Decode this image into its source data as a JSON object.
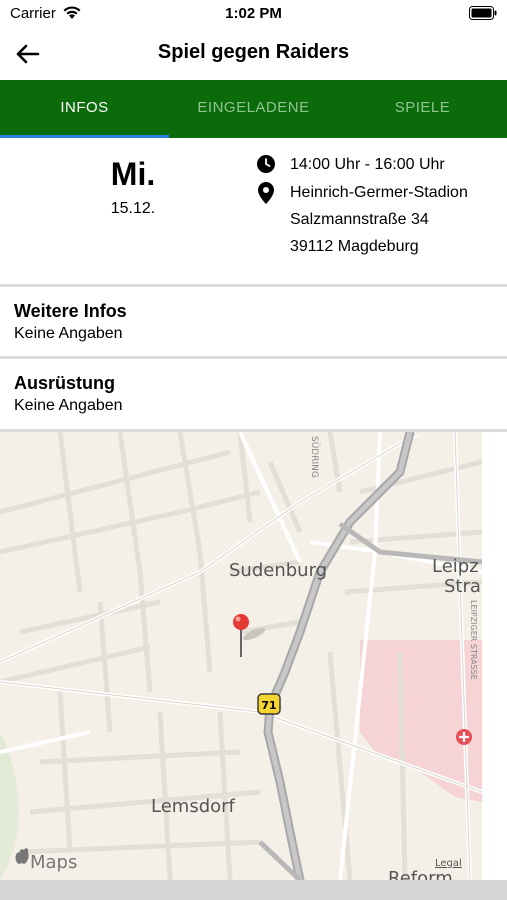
{
  "status": {
    "carrier": "Carrier",
    "time": "1:02 PM"
  },
  "nav": {
    "title": "Spiel gegen Raiders"
  },
  "tabs": [
    {
      "label": "INFOS",
      "active": true
    },
    {
      "label": "EINGELADENE",
      "active": false
    },
    {
      "label": "SPIELE",
      "active": false
    }
  ],
  "event": {
    "weekday": "Mi.",
    "date": "15.12.",
    "time_range": "14:00 Uhr - 16:00 Uhr",
    "venue": "Heinrich-Germer-Stadion",
    "street": "Salzmannstraße 34",
    "city": "39112 Magdeburg"
  },
  "sections": {
    "info": {
      "title": "Weitere Infos",
      "value": "Keine Angaben"
    },
    "equipment": {
      "title": "Ausrüstung",
      "value": "Keine Angaben"
    }
  },
  "map": {
    "labels": {
      "sudenburg": "Sudenburg",
      "lemsdorf": "Lemsdorf",
      "leipz": "Leipz",
      "stra": "Stra",
      "reform": "Reform",
      "sudring": "SÜDRING",
      "leipziger": "LEIPZIGER STRASSE",
      "road": "71"
    },
    "attribution": "Maps",
    "legal": "Legal"
  },
  "colors": {
    "tab_bar": "#0b6b0b",
    "tab_indicator": "#2a7fe0",
    "pin": "#e53935"
  }
}
